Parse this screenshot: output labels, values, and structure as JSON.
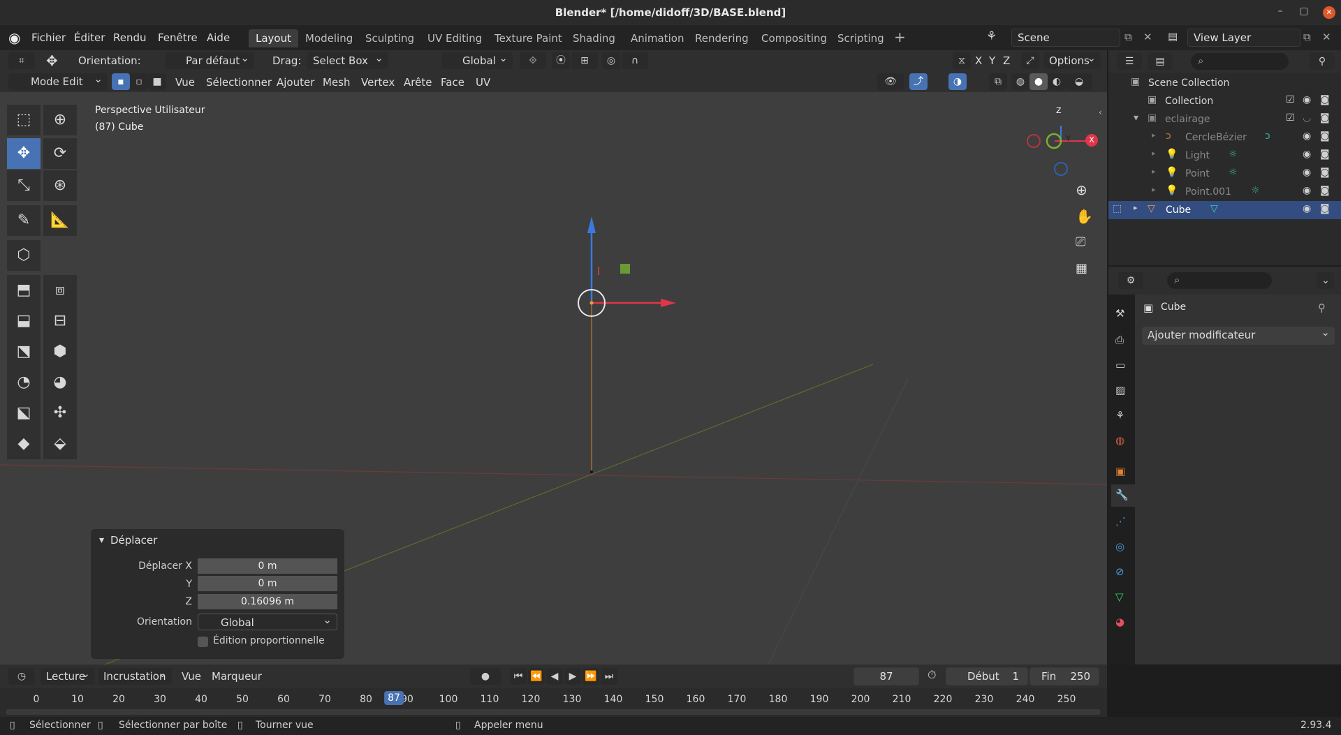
{
  "window": {
    "title": "Blender* [/home/didoff/3D/BASE.blend]",
    "min": "–",
    "max": "▢",
    "close": "✕"
  },
  "menu": [
    "Fichier",
    "Éditer",
    "Rendu",
    "Fenêtre",
    "Aide"
  ],
  "workspaces": [
    "Layout",
    "Modeling",
    "Sculpting",
    "UV Editing",
    "Texture Paint",
    "Shading",
    "Animation",
    "Rendering",
    "Compositing",
    "Scripting"
  ],
  "scene": "Scene",
  "view_layer": "View Layer",
  "header": {
    "orientation_label": "Orientation:",
    "orientation_value": "Par défaut",
    "drag_label": "Drag:",
    "drag_value": "Select Box",
    "transform_value": "Global",
    "axis_x": "X",
    "axis_y": "Y",
    "axis_z": "Z",
    "options": "Options",
    "mode": "Mode Edit",
    "menus": [
      "Vue",
      "Sélectionner",
      "Ajouter",
      "Mesh",
      "Vertex",
      "Arête",
      "Face",
      "UV"
    ]
  },
  "viewport": {
    "view_name": "Perspective Utilisateur",
    "object_info": "(87) Cube",
    "gizmo": {
      "z": "Z",
      "y": "Y",
      "x": "X"
    }
  },
  "operator_panel": {
    "title": "Déplacer",
    "x_label": "Déplacer X",
    "x_value": "0 m",
    "y_label": "Y",
    "y_value": "0 m",
    "z_label": "Z",
    "z_value": "0.16096 m",
    "orient_label": "Orientation",
    "orient_value": "Global",
    "proportional": "Édition proportionnelle"
  },
  "outliner": {
    "root": "Scene Collection",
    "items": [
      {
        "name": "Collection",
        "dim": false
      },
      {
        "name": "eclairage",
        "dim": true
      },
      {
        "name": "CercleBézier",
        "dim": true
      },
      {
        "name": "Light",
        "dim": true
      },
      {
        "name": "Point",
        "dim": true
      },
      {
        "name": "Point.001",
        "dim": true
      },
      {
        "name": "Cube",
        "dim": false,
        "selected": true
      }
    ]
  },
  "properties": {
    "object_name": "Cube",
    "add_modifier": "Ajouter modificateur"
  },
  "timeline": {
    "playback": "Lecture",
    "keying": "Incrustation",
    "view": "Vue",
    "marker": "Marqueur",
    "current_frame": "87",
    "start_label": "Début",
    "start_value": "1",
    "end_label": "Fin",
    "end_value": "250",
    "ticks": [
      "0",
      "10",
      "20",
      "30",
      "40",
      "50",
      "60",
      "70",
      "80",
      "90",
      "100",
      "110",
      "120",
      "130",
      "140",
      "150",
      "160",
      "170",
      "180",
      "190",
      "200",
      "210",
      "220",
      "230",
      "240",
      "250"
    ]
  },
  "status": {
    "select": "Sélectionner",
    "box_select": "Sélectionner par boîte",
    "rotate": "Tourner vue",
    "menu": "Appeler menu",
    "version": "2.93.4"
  }
}
